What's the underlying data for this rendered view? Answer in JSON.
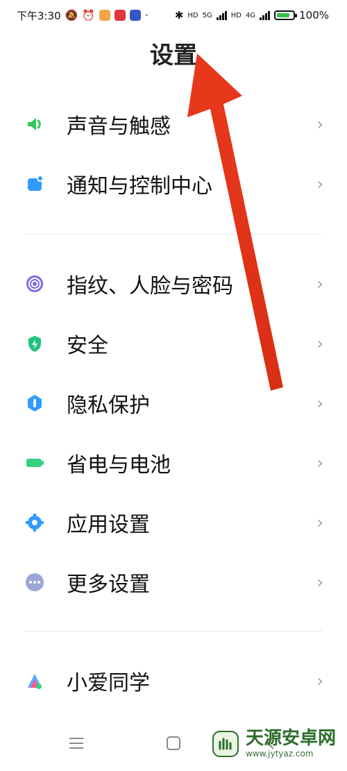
{
  "status": {
    "time": "下午3:30",
    "network_5g": "5G",
    "network_4g": "4G",
    "hd1": "HD",
    "hd2": "HD",
    "battery": "100%"
  },
  "header": {
    "title": "设置"
  },
  "groups": [
    [
      {
        "label": "声音与触感",
        "icon": "speaker-icon",
        "color": "#34c759"
      },
      {
        "label": "通知与控制中心",
        "icon": "notification-icon",
        "color": "#2f9bff"
      }
    ],
    [
      {
        "label": "指纹、人脸与密码",
        "icon": "fingerprint-icon",
        "color": "#7b69e8"
      },
      {
        "label": "安全",
        "icon": "shield-bolt-icon",
        "color": "#1ec27a"
      },
      {
        "label": "隐私保护",
        "icon": "privacy-icon",
        "color": "#2f9bff"
      },
      {
        "label": "省电与电池",
        "icon": "battery-icon",
        "color": "#35d07f"
      },
      {
        "label": "应用设置",
        "icon": "gear-icon",
        "color": "#2f9bff"
      },
      {
        "label": "更多设置",
        "icon": "more-dots-icon",
        "color": "#9aa7d6"
      }
    ],
    [
      {
        "label": "小爱同学",
        "icon": "xiaoai-icon",
        "color": "#5aa8ff"
      }
    ]
  ],
  "watermark": {
    "name": "天源安卓网",
    "url": "www.jytyaz.com"
  },
  "colors": {
    "annotation_arrow": "#ea3d1f"
  }
}
